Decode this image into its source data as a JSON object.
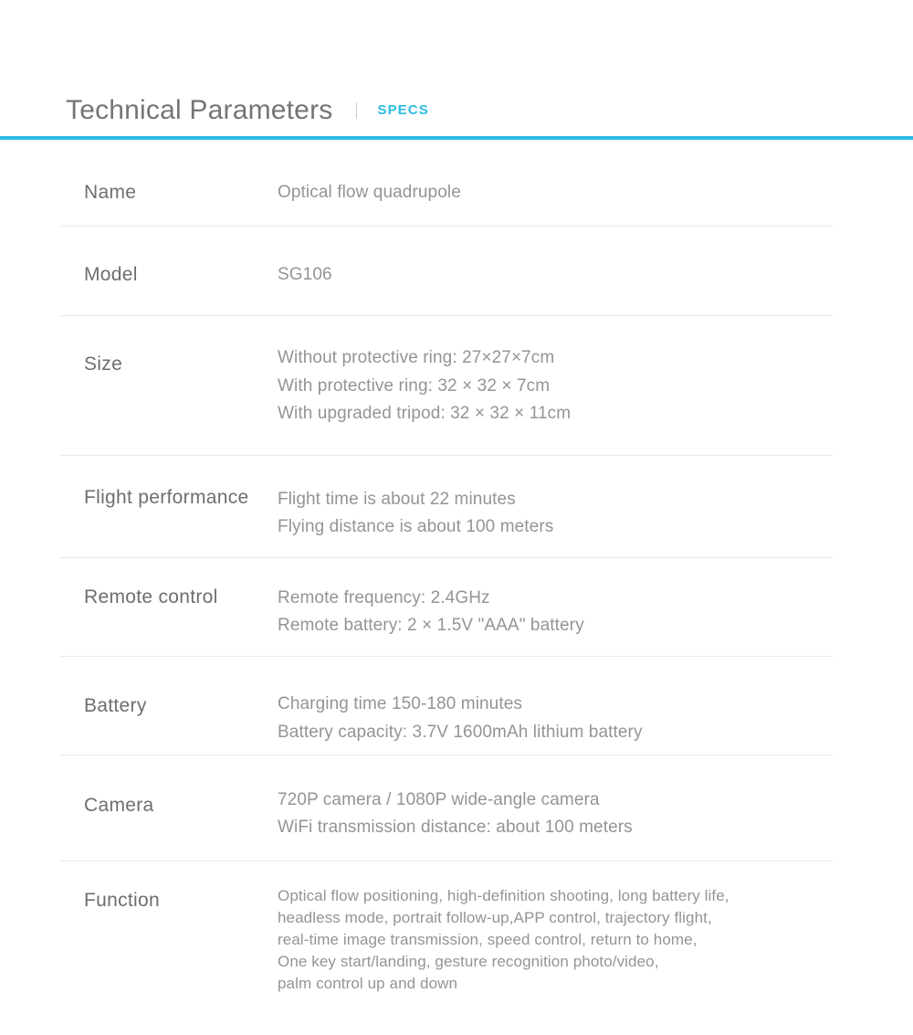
{
  "header": {
    "title": "Technical Parameters",
    "tag": "SPECS",
    "accent_color": "#2BBCE2",
    "separator": "vertical-divider"
  },
  "spec_table": {
    "rows": [
      {
        "label": "Name",
        "lines": [
          "Optical flow quadrupole"
        ]
      },
      {
        "label": "Model",
        "lines": [
          "SG106"
        ]
      },
      {
        "label": "Size",
        "lines": [
          "Without protective ring: 27×27×7cm",
          "With protective ring: 32 × 32 × 7cm",
          "With upgraded tripod: 32 × 32 × 11cm"
        ]
      },
      {
        "label": "Flight performance",
        "lines": [
          "Flight time is about 22 minutes",
          "Flying distance is about 100 meters"
        ]
      },
      {
        "label": "Remote control",
        "lines": [
          "Remote frequency: 2.4GHz",
          "Remote battery: 2 × 1.5V \"AAA\" battery"
        ]
      },
      {
        "label": "Battery",
        "lines": [
          "Charging time 150-180 minutes",
          "Battery capacity: 3.7V 1600mAh lithium battery"
        ]
      },
      {
        "label": "Camera",
        "lines": [
          "720P camera / 1080P wide-angle camera",
          "WiFi transmission distance: about 100 meters"
        ]
      },
      {
        "label": "Function",
        "lines": [
          "Optical flow positioning, high-definition shooting, long battery life,",
          "headless mode, portrait follow-up,APP control, trajectory flight,",
          "real-time image transmission, speed control, return to home,",
          "One key start/landing, gesture recognition photo/video,",
          "palm control up and down"
        ]
      }
    ]
  },
  "colors": {
    "accent": "#2BBCE2",
    "label_text": "#6E6E6E",
    "value_text": "#949494",
    "title_text": "#757575",
    "divider": "#EAEAEA",
    "background": "#FFFFFF"
  }
}
